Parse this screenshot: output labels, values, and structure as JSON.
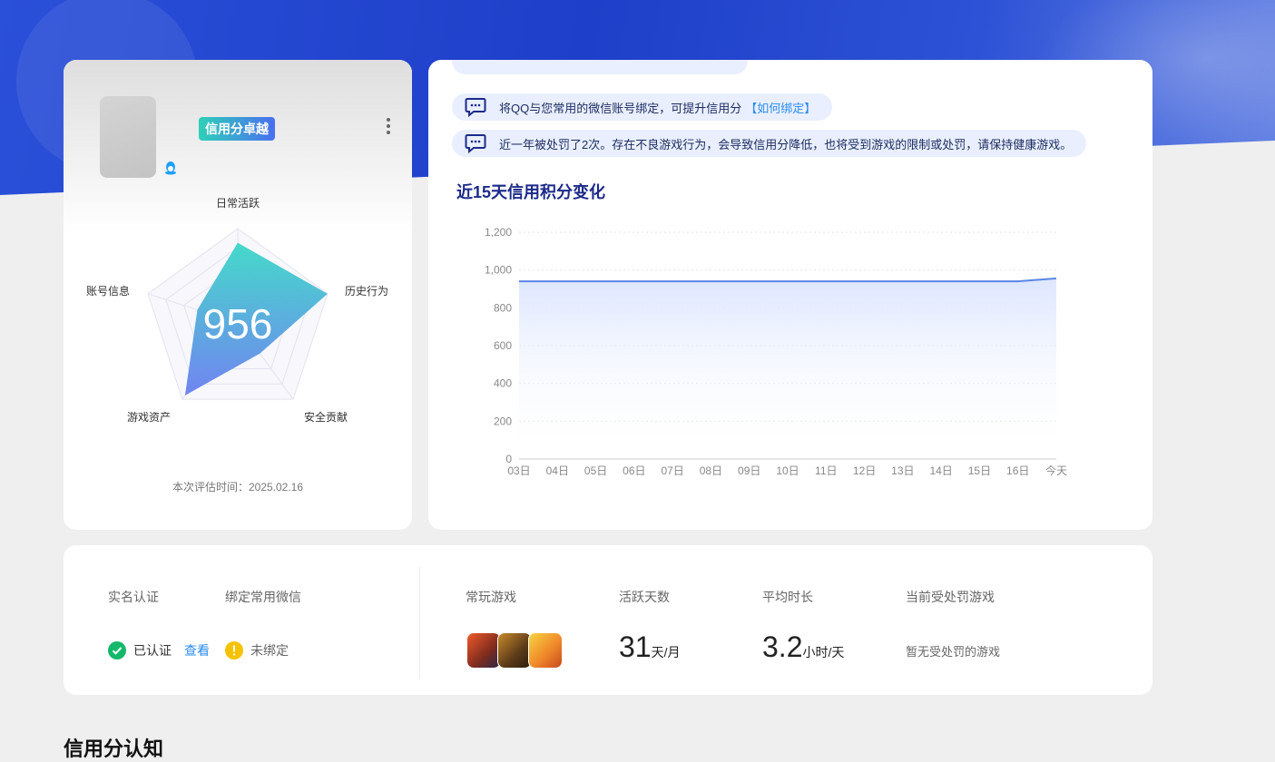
{
  "profile": {
    "badge": "信用分卓越",
    "score": "956",
    "eval_time": "本次评估时间：2025.02.16",
    "radar_axes": [
      "日常活跃",
      "历史行为",
      "安全贡献",
      "游戏资产",
      "账号信息"
    ],
    "radar_values": [
      0.85,
      1.0,
      0.4,
      0.95,
      0.45
    ],
    "gradient_colors": [
      "#3cd8c8",
      "#6a7ef0"
    ]
  },
  "tips": {
    "bind_text": "将QQ与您常用的微信账号绑定，可提升信用分",
    "bind_link": "【如何绑定】",
    "penalty_text": "近一年被处罚了2次。存在不良游戏行为，会导致信用分降低，也将受到游戏的限制或处罚，请保持健康游戏。"
  },
  "chart_title": "近15天信用积分变化",
  "chart_data": {
    "type": "area",
    "categories": [
      "03日",
      "04日",
      "05日",
      "06日",
      "07日",
      "08日",
      "09日",
      "10日",
      "11日",
      "12日",
      "13日",
      "14日",
      "15日",
      "16日",
      "今天"
    ],
    "values": [
      940,
      940,
      940,
      940,
      940,
      940,
      940,
      940,
      940,
      940,
      940,
      940,
      940,
      940,
      956
    ],
    "y_ticks": [
      "0",
      "200",
      "400",
      "600",
      "800",
      "1,000",
      "1,200"
    ],
    "ylim": [
      0,
      1200
    ],
    "grid": true,
    "line_color": "#5b86e5",
    "fill_color": "#dde6ff"
  },
  "stats": {
    "realname_label": "实名认证",
    "wechat_label": "绑定常用微信",
    "verified_text": "已认证",
    "view_link": "查看",
    "unbound_text": "未绑定",
    "games_label": "常玩游戏",
    "active_label": "活跃天数",
    "active_value": "31",
    "active_unit": "天/月",
    "avg_label": "平均时长",
    "avg_value": "3.2",
    "avg_unit": "小时/天",
    "penalty_label": "当前受处罚游戏",
    "penalty_value": "暂无受处罚的游戏",
    "game_icons": [
      "honor-of-kings-icon",
      "game-icon-2",
      "naruto-icon"
    ]
  },
  "next_section": "信用分认知"
}
